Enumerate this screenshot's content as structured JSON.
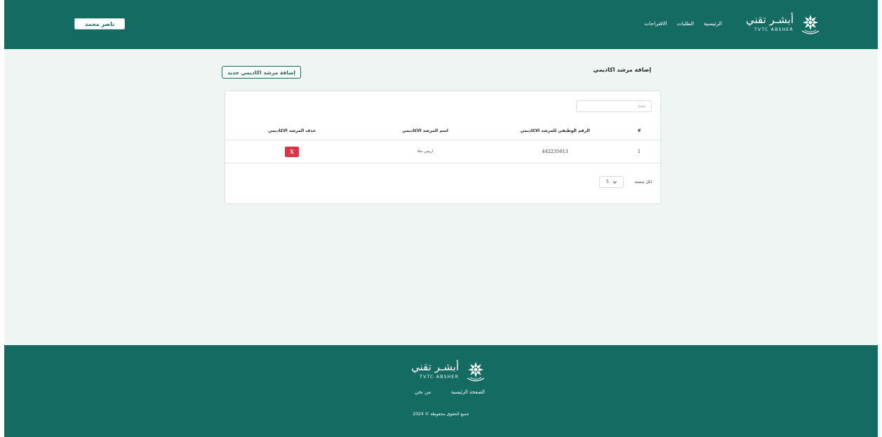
{
  "header": {
    "user_name": "ناصر محمد",
    "nav": [
      "الرئيسية",
      "الطلبات",
      "الاقتراحات"
    ],
    "logo_ar": "أبشـر تقني",
    "logo_en": "TVTC ABSHER"
  },
  "main": {
    "page_title": "إضافة مرشد اكاديمي",
    "add_button": "إضافة مرشد اكاديمي جديد",
    "search_placeholder": "بحث",
    "table": {
      "headers": [
        "#",
        "الرقم الوظيفي للمرشد الاكاديمي",
        "اسم المرشد الاكاديمي",
        "حذف المرشد الاكاديمي"
      ],
      "rows": [
        {
          "index": "1",
          "employee_id": "442235613",
          "name": "اريس سلا",
          "delete_label": "X"
        }
      ]
    },
    "per_page_label": "لكل صفحة",
    "per_page_value": "5"
  },
  "footer": {
    "logo_ar": "أبشـر تقني",
    "logo_en": "TVTC ABSHER",
    "links": [
      "الصفحة الرئيسية",
      "من نحن"
    ],
    "copyright": "جميع الحقوق محفوظة © 2024"
  },
  "colors": {
    "brand": "#146b61",
    "page_bg": "#eef5f2",
    "danger": "#dc3545"
  }
}
